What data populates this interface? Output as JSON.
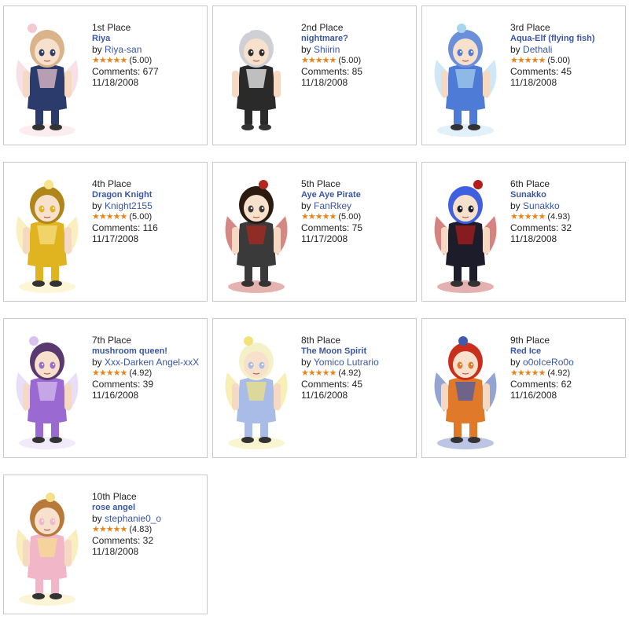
{
  "cards": [
    {
      "place": "1st Place",
      "title": "Riya",
      "by_prefix": "by",
      "author": "Riya-san",
      "stars": "★★★★★",
      "score": "(5.00)",
      "comments": "Comments: 677",
      "date": "11/18/2008",
      "avatar": "bunny-girl",
      "colors": {
        "main": "#2b3b6b",
        "accent": "#f3c9d2",
        "hair": "#d9b48a"
      }
    },
    {
      "place": "2nd Place",
      "title": "nightmare?",
      "by_prefix": "by",
      "author": "Shiirin",
      "stars": "★★★★★",
      "score": "(5.00)",
      "comments": "Comments: 85",
      "date": "11/18/2008",
      "avatar": "dark-gothic",
      "colors": {
        "main": "#2a2a2a",
        "accent": "#ffffff",
        "hair": "#cfcfd6"
      }
    },
    {
      "place": "3rd Place",
      "title": "Aqua-Elf (flying fish)",
      "by_prefix": "by",
      "author": "Dethali",
      "stars": "★★★★★",
      "score": "(5.00)",
      "comments": "Comments: 45",
      "date": "11/18/2008",
      "avatar": "mermaid",
      "colors": {
        "main": "#4d7bd6",
        "accent": "#a9d4ee",
        "hair": "#6b8fd8"
      }
    },
    {
      "place": "4th Place",
      "title": "Dragon Knight",
      "by_prefix": "by",
      "author": "Knight2155",
      "stars": "★★★★★",
      "score": "(5.00)",
      "comments": "Comments: 116",
      "date": "11/17/2008",
      "avatar": "gold-dragon",
      "colors": {
        "main": "#e0b320",
        "accent": "#f6e38a",
        "hair": "#b0851a"
      }
    },
    {
      "place": "5th Place",
      "title": "Aye Aye Pirate",
      "by_prefix": "by",
      "author": "FanRkey",
      "stars": "★★★★★",
      "score": "(5.00)",
      "comments": "Comments: 75",
      "date": "11/17/2008",
      "avatar": "pirate",
      "colors": {
        "main": "#3a3a3a",
        "accent": "#b3261e",
        "hair": "#2a1a10"
      }
    },
    {
      "place": "6th Place",
      "title": "Sunakko",
      "by_prefix": "by",
      "author": "Sunakko",
      "stars": "★★★★★",
      "score": "(4.93)",
      "comments": "Comments: 32",
      "date": "11/18/2008",
      "avatar": "dark-bat",
      "colors": {
        "main": "#1c1c2a",
        "accent": "#b51c1c",
        "hair": "#3f5ee0"
      }
    },
    {
      "place": "7th Place",
      "title": "mushroom queen!",
      "by_prefix": "by",
      "author": "Xxx-Darken Angel-xxX",
      "stars": "★★★★★",
      "score": "(4.92)",
      "comments": "Comments: 39",
      "date": "11/16/2008",
      "avatar": "mushroom",
      "colors": {
        "main": "#9a6ad2",
        "accent": "#d7c2f0",
        "hair": "#5a3a6e"
      }
    },
    {
      "place": "8th Place",
      "title": "The Moon Spirit",
      "by_prefix": "by",
      "author": "Yomico Lutrario",
      "stars": "★★★★★",
      "score": "(4.92)",
      "comments": "Comments: 45",
      "date": "11/16/2008",
      "avatar": "moon-angel",
      "colors": {
        "main": "#a9bce8",
        "accent": "#f2e27a",
        "hair": "#f4f1c8"
      }
    },
    {
      "place": "9th Place",
      "title": "Red Ice",
      "by_prefix": "by",
      "author": "o0oIceRo0o",
      "stars": "★★★★★",
      "score": "(4.92)",
      "comments": "Comments: 62",
      "date": "11/16/2008",
      "avatar": "fire-fox",
      "colors": {
        "main": "#e07a2a",
        "accent": "#3f5ab0",
        "hair": "#c9301c"
      }
    },
    {
      "place": "10th Place",
      "title": "rose angel",
      "by_prefix": "by",
      "author": "stephanie0_o",
      "stars": "★★★★★",
      "score": "(4.83)",
      "comments": "Comments: 32",
      "date": "11/18/2008",
      "avatar": "rose-angel",
      "colors": {
        "main": "#f1b6c8",
        "accent": "#f5e08a",
        "hair": "#b77a3a"
      }
    }
  ]
}
